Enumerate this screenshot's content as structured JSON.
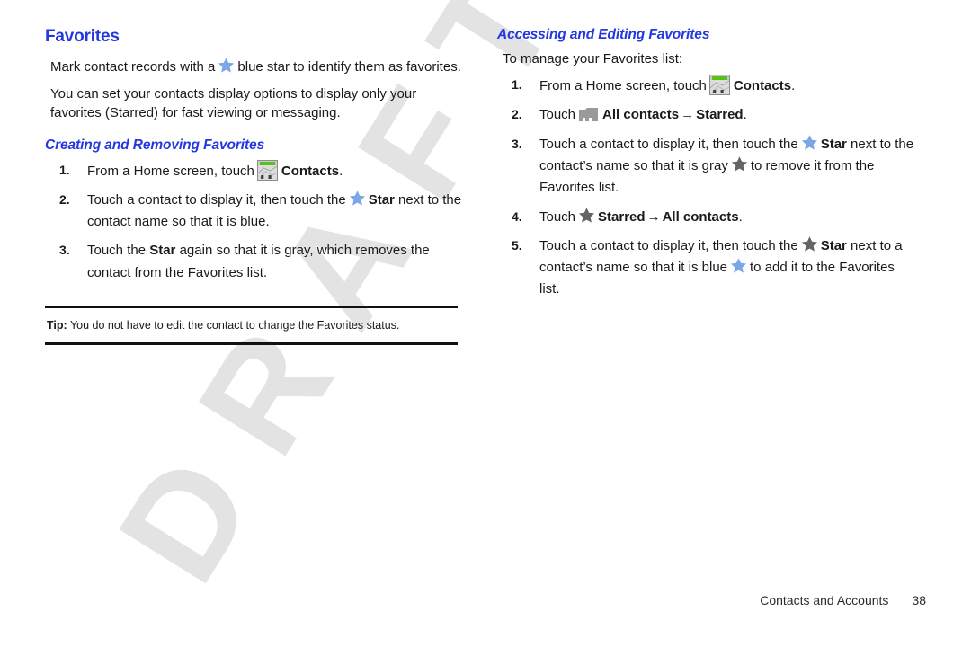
{
  "watermark": {
    "text": "DRAFT",
    "color": "#e3e3e3"
  },
  "colors": {
    "heading_blue": "#2438e0",
    "star_blue": "#7ba6e8",
    "star_gray": "#646464",
    "text_black": "#1a1a1a",
    "icon_green": "#56c417"
  },
  "left_column": {
    "heading": "Favorites",
    "intro_paragraph_1": {
      "before_star": "Mark contact records with a",
      "after_star": "blue star to identify them as favorites."
    },
    "intro_paragraph_2": "You can set your contacts display options to display only your favorites (Starred) for fast viewing or messaging.",
    "subheading": "Creating and Removing Favorites",
    "steps": [
      {
        "num": "1.",
        "part1": "From a Home screen, touch",
        "icon": "contacts-icon",
        "bold1": "Contacts",
        "part2": "."
      },
      {
        "num": "2.",
        "part1": "Touch a contact to display it, then touch the",
        "icon": "star-blue-icon",
        "bold1": "Star",
        "part2": "next to the contact name so that it is blue."
      },
      {
        "num": "3.",
        "part1": "Touch the",
        "bold1": "Star",
        "part2": "again so that it is gray, which removes the contact from the Favorites list."
      }
    ],
    "tip": {
      "label": "Tip:",
      "text": "You do not have to edit the contact to change the Favorites status."
    }
  },
  "right_column": {
    "heading": "Accessing and Editing Favorites",
    "intro": "To manage your Favorites list:",
    "steps": [
      {
        "num": "1.",
        "part1": "From a Home screen, touch",
        "icon": "contacts-icon",
        "bold1": "Contacts",
        "part2": "."
      },
      {
        "num": "2.",
        "part1": "Touch",
        "icon": "folder-icon",
        "bold1": "All contacts",
        "arrow": "→",
        "bold2": "Starred",
        "part2": "."
      },
      {
        "num": "3.",
        "part1": "Touch a contact to display it, then touch the",
        "icon": "star-blue-icon",
        "bold1": "Star",
        "part2": "next to the contact’s name so that it is gray",
        "icon2": "star-gray-icon",
        "part3": "to remove it from the Favorites list."
      },
      {
        "num": "4.",
        "part1": "Touch",
        "icon": "star-gray-icon",
        "bold1": "Starred",
        "arrow": "→",
        "bold2": "All contacts",
        "part2": "."
      },
      {
        "num": "5.",
        "part1": "Touch a contact to display it, then touch the",
        "icon": "star-gray-icon",
        "bold1": "Star",
        "part2": "next to a contact’s name so that it is blue",
        "icon2": "star-blue-icon",
        "part3": "to add it to the Favorites list."
      }
    ]
  },
  "footer": {
    "section": "Contacts and Accounts",
    "page_number": "38"
  }
}
